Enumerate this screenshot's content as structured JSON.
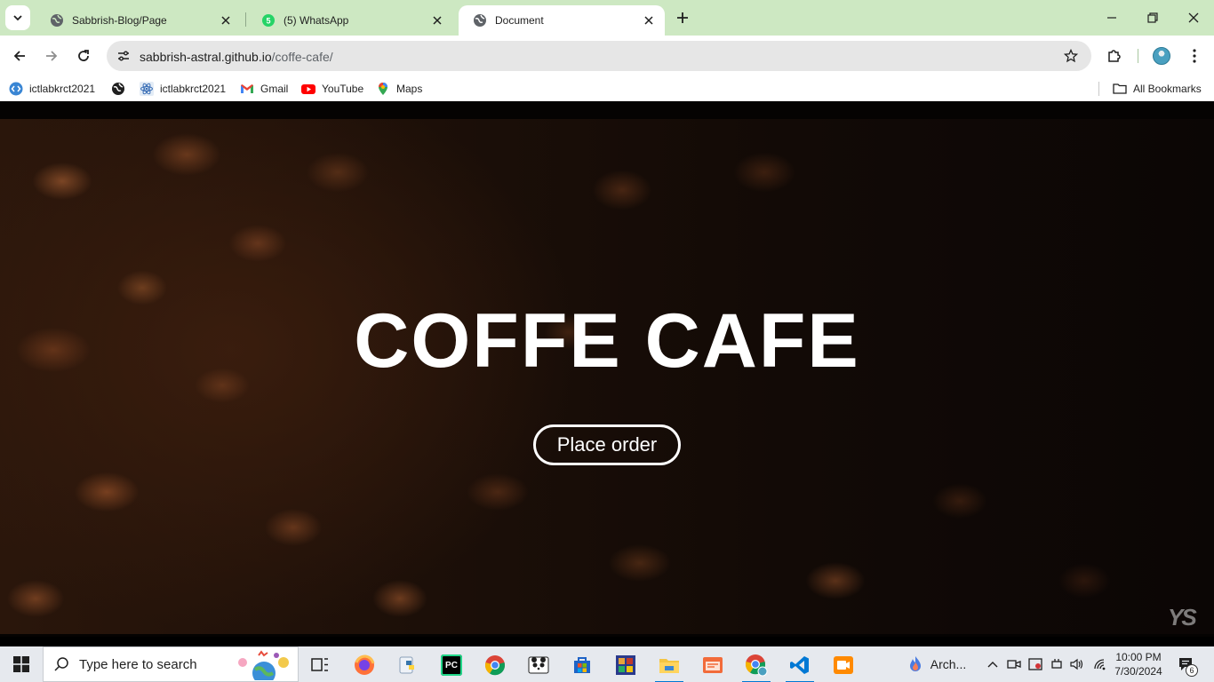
{
  "browser": {
    "tabs": [
      {
        "title": "Sabbrish-Blog/Page",
        "favicon": "globe-icon",
        "active": false
      },
      {
        "title": "(5) WhatsApp",
        "favicon": "whatsapp-icon",
        "active": false
      },
      {
        "title": "Document",
        "favicon": "globe-icon",
        "active": true
      }
    ],
    "address": {
      "host": "sabbrish-astral.github.io",
      "path": "/coffe-cafe/"
    },
    "bookmarks": [
      {
        "label": "ictlabkrct2021",
        "icon": "code-icon"
      },
      {
        "label": "",
        "icon": "globe-icon"
      },
      {
        "label": "ictlabkrct2021",
        "icon": "react-icon"
      },
      {
        "label": "Gmail",
        "icon": "gmail-icon"
      },
      {
        "label": "YouTube",
        "icon": "youtube-icon"
      },
      {
        "label": "Maps",
        "icon": "maps-pin-icon"
      }
    ],
    "all_bookmarks_label": "All Bookmarks"
  },
  "page": {
    "hero_title": "COFFE CAFE",
    "order_button": "Place order",
    "logo_mark": "YS"
  },
  "taskbar": {
    "search_placeholder": "Type here to search",
    "pinned_apps": [
      "task-view",
      "firefox",
      "python",
      "pycharm",
      "chrome",
      "panda-app",
      "microsoft-store",
      "game-app",
      "file-explorer",
      "app-window",
      "chrome-active",
      "vs-code",
      "recorder-app"
    ],
    "running_label": "Arch...",
    "clock_time": "10:00 PM",
    "clock_date": "7/30/2024",
    "notification_count": "6"
  },
  "colors": {
    "tabstrip": "#cde8c2",
    "omnibox": "#e6e6e6",
    "taskbar": "#e6e9ee",
    "accent": "#0078d4"
  }
}
